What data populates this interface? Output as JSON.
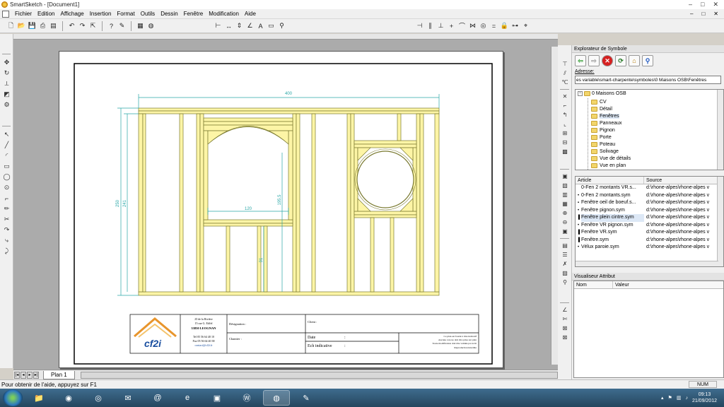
{
  "window": {
    "title": "SmartSketch - [Document1]",
    "buttons": [
      "–",
      "□",
      "✕"
    ]
  },
  "menu": {
    "items": [
      "Fichier",
      "Edition",
      "Affichage",
      "Insertion",
      "Format",
      "Outils",
      "Dessin",
      "Fenêtre",
      "Modification",
      "Aide"
    ],
    "doc_buttons": [
      "–",
      "□",
      "✕"
    ]
  },
  "toolbar": {
    "icons": [
      "new-icon",
      "open-icon",
      "save-icon",
      "print-icon",
      "print-preview-icon",
      "undo-icon",
      "redo-icon",
      "select-icon",
      "help-icon",
      "brush-icon",
      "layers-icon",
      "globe-icon",
      "dimension-icon",
      "smart-dimension-icon",
      "align-icon",
      "text-icon",
      "label-icon",
      "magnify-icon",
      "relation-icon",
      "parallel-icon",
      "perpendicular-icon",
      "tangent-icon",
      "symmetry-icon",
      "lock-icon",
      "connect-icon"
    ]
  },
  "drawing": {
    "dim_top": "400",
    "dim_left_outer": "250",
    "dim_left_inner": "241",
    "dim_window_width": "120",
    "dim_window_height": "195.5",
    "dim_door": "91"
  },
  "title_block": {
    "logo": "cf2i",
    "address_lines": [
      "ZI de la Rivière",
      "15 rue G. Eiffel",
      "33850 LEOGNAN",
      "Tel 05 56 64 40 10",
      "Fax 05 56 64 40 38",
      "contact@cf2i.fr"
    ],
    "designation_label": "Désignation :",
    "chantier_label": "Chantier :",
    "client_label": "Client :",
    "date_label": "Date",
    "date_colon": ":",
    "ech_label": "Ech indicative",
    "ech_colon": ":",
    "notice_lines": [
      "Ce plan est fourni à titre indicatif",
      "Aucune cote ne doit être prise sur plan",
      "Toute modification doit être validée par écrit",
      "Reproduction interdite"
    ]
  },
  "tabs": {
    "plan": "Plan 1"
  },
  "explorer": {
    "title": "Explorateur de Symbole",
    "address_label": "Adresse:",
    "address_value": "es variable\\smart-charpente\\symboles\\0 Maisons OSB\\Fenêtres",
    "tree_root": "0 Maisons OSB",
    "tree_items": [
      "CV",
      "Détail",
      "Fenêtres",
      "Panneaux",
      "Pignon",
      "Porte",
      "Poteau",
      "Solivage",
      "Vue de détails",
      "Vue en plan"
    ],
    "selected_tree_item": "Fenêtres",
    "columns": [
      "Article",
      "Source"
    ],
    "articles": [
      {
        "icon": " ",
        "name": "0-Fen 2 montants VR.s...",
        "source": "d:\\rhone-alpes\\rhone-alpes v"
      },
      {
        "icon": "•",
        "name": "0-Fen 2 montants.sym",
        "source": "d:\\rhone-alpes\\rhone-alpes v"
      },
      {
        "icon": "▪",
        "name": "Fenêtre oeil de boeuf.s...",
        "source": "d:\\rhone-alpes\\rhone-alpes v"
      },
      {
        "icon": "•",
        "name": "Fenêtre pignon.sym",
        "source": "d:\\rhone-alpes\\rhone-alpes v"
      },
      {
        "icon": "▐",
        "name": "Fenêtre plein cintre.sym",
        "source": "d:\\rhone-alpes\\rhone-alpes v"
      },
      {
        "icon": "•",
        "name": "Fenêtre VR pignon.sym",
        "source": "d:\\rhone-alpes\\rhone-alpes v"
      },
      {
        "icon": "▐",
        "name": "Fenêtre VR.sym",
        "source": "d:\\rhone-alpes\\rhone-alpes v"
      },
      {
        "icon": "▐",
        "name": "Fenêtre.sym",
        "source": "d:\\rhone-alpes\\rhone-alpes v"
      },
      {
        "icon": "•",
        "name": "Vélux paroie.sym",
        "source": "d:\\rhone-alpes\\rhone-alpes v"
      }
    ],
    "selected_article": "Fenêtre plein cintre.sym"
  },
  "attributes": {
    "title": "Visualiseur Attribut",
    "columns": [
      "Nom",
      "Valeur"
    ]
  },
  "status": {
    "help": "Pour obtenir de l'aide, appuyez sur F1",
    "num": "NUM"
  },
  "taskbar": {
    "time": "09:13",
    "date": "21/09/2012",
    "apps": [
      "folder-icon",
      "media-icon",
      "chrome-icon",
      "mail-icon",
      "snail-icon",
      "ie-icon",
      "app99-icon",
      "wordpress-icon",
      "smartsketch-icon",
      "paint-icon"
    ]
  },
  "colors": {
    "timber": "#fdf5a6",
    "timber_stroke": "#7a7a30",
    "dimension": "#2aa7a7",
    "logo_blue": "#1a4fa0",
    "logo_orange": "#e8952c"
  }
}
